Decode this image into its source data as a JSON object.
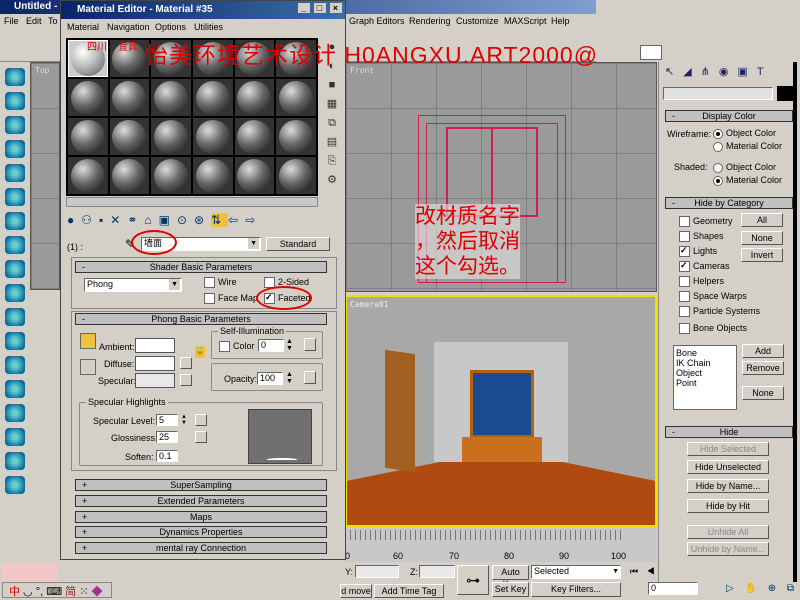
{
  "main_window": {
    "title": "Untitled -",
    "menu": [
      "File",
      "Edit",
      "To",
      "Graph Editors",
      "Rendering",
      "Customize",
      "MAXScript",
      "Help"
    ]
  },
  "viewports": {
    "top": "Top",
    "front": "Front",
    "camera": "Camera01"
  },
  "material_editor": {
    "title": "Material Editor - Material #35",
    "menu": [
      "Material",
      "Navigation",
      "Options",
      "Utilities"
    ],
    "level": "(1) :",
    "material_name": "墙面",
    "material_type": "Standard",
    "shader_rollout": "Shader Basic Parameters",
    "shader": "Phong",
    "wire": {
      "label": "Wire",
      "checked": false
    },
    "two_sided": {
      "label": "2-Sided",
      "checked": false
    },
    "face_map": {
      "label": "Face Map",
      "checked": false
    },
    "faceted": {
      "label": "Faceted",
      "checked": true
    },
    "phong_rollout": "Phong Basic Parameters",
    "self_illum": "Self-Illumination",
    "color_label": "Color",
    "color_value": "0",
    "ambient": "Ambient:",
    "diffuse": "Diffuse:",
    "specular": "Specular:",
    "opacity_label": "Opacity:",
    "opacity": "100",
    "spec_group": "Specular Highlights",
    "spec_level_label": "Specular Level:",
    "spec_level": "5",
    "gloss_label": "Glossiness:",
    "gloss": "25",
    "soften_label": "Soften:",
    "soften": "0.1",
    "rollouts": [
      "SuperSampling",
      "Extended Parameters",
      "Maps",
      "Dynamics Properties",
      "mental ray Connection"
    ]
  },
  "watermark": {
    "tags": [
      "四川",
      "宜宾"
    ],
    "text": "怡美环境艺术设计 H0ANGXU.ART2000@"
  },
  "annotation": [
    "改材质名字",
    "，然后取消",
    "这个勾选。"
  ],
  "command_panel": {
    "display_color": "Display Color",
    "wireframe": "Wireframe:",
    "shaded": "Shaded:",
    "object_color": "Object Color",
    "material_color": "Material Color",
    "hide_by_category": "Hide by Category",
    "categories": [
      {
        "label": "Geometry",
        "checked": false
      },
      {
        "label": "Shapes",
        "checked": false
      },
      {
        "label": "Lights",
        "checked": true
      },
      {
        "label": "Cameras",
        "checked": true
      },
      {
        "label": "Helpers",
        "checked": false
      },
      {
        "label": "Space Warps",
        "checked": false
      },
      {
        "label": "Particle Systems",
        "checked": false
      },
      {
        "label": "Bone Objects",
        "checked": false
      }
    ],
    "all": "All",
    "none": "None",
    "invert": "Invert",
    "list": [
      "Bone",
      "IK Chain Object",
      "Point"
    ],
    "add": "Add",
    "remove": "Remove",
    "hide": "Hide",
    "hide_selected": "Hide Selected",
    "hide_unselected": "Hide Unselected",
    "hide_by_name": "Hide by Name...",
    "hide_by_hit": "Hide by Hit",
    "unhide_all": "Unhide All",
    "unhide_by_name": "Unhide by Name..."
  },
  "timeline": {
    "ticks": [
      "0",
      "60",
      "70",
      "80",
      "90",
      "100"
    ]
  },
  "status": {
    "y": "Y:",
    "z": "Z:",
    "auto_key": "Auto Key",
    "set_key": "Set Key",
    "selected": "Selected",
    "key_filters": "Key Filters...",
    "frame": "0",
    "move": "d move",
    "add_time_tag": "Add Time Tag"
  },
  "ime": {
    "mode": "中",
    "simplified": "简"
  }
}
